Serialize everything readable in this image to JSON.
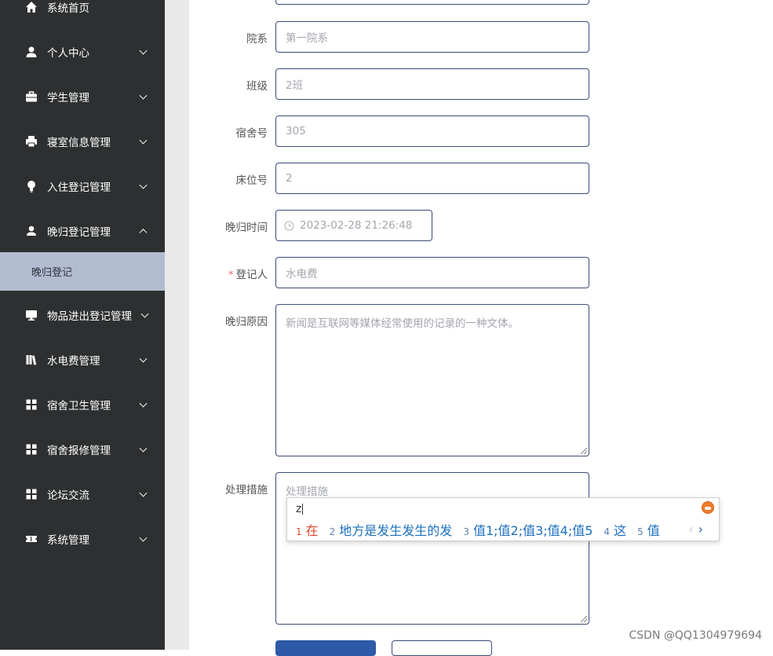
{
  "sidebar": {
    "items": [
      {
        "label": "系统首页",
        "icon": "home-icon"
      },
      {
        "label": "个人中心",
        "icon": "person-icon"
      },
      {
        "label": "学生管理",
        "icon": "briefcase-icon"
      },
      {
        "label": "寝室信息管理",
        "icon": "printer-icon"
      },
      {
        "label": "入住登记管理",
        "icon": "lightbulb-icon"
      },
      {
        "label": "晚归登记管理",
        "icon": "user-icon"
      },
      {
        "label": "物品进出登记管理",
        "icon": "monitor-icon"
      },
      {
        "label": "水电费管理",
        "icon": "book-icon"
      },
      {
        "label": "宿舍卫生管理",
        "icon": "grid-icon"
      },
      {
        "label": "宿舍报修管理",
        "icon": "grid-icon"
      },
      {
        "label": "论坛交流",
        "icon": "grid-icon"
      },
      {
        "label": "系统管理",
        "icon": "ticket-icon"
      }
    ],
    "sub_item": "晚归登记"
  },
  "form": {
    "department": {
      "label": "院系",
      "value": "第一院系"
    },
    "class": {
      "label": "班级",
      "value": "2班"
    },
    "dorm_no": {
      "label": "宿舍号",
      "value": "305"
    },
    "bed_no": {
      "label": "床位号",
      "value": "2"
    },
    "late_time": {
      "label": "晚归时间",
      "value": "2023-02-28 21:26:48"
    },
    "registrar": {
      "label": "登记人",
      "value": "水电费",
      "required_mark": "*"
    },
    "reason": {
      "label": "晚归原因",
      "value": "新闻是互联网等媒体经常使用的记录的一种文体。"
    },
    "measures": {
      "label": "处理措施",
      "placeholder": "处理措施"
    }
  },
  "ime": {
    "composition": "z",
    "candidates": [
      {
        "num": "1",
        "text": "在"
      },
      {
        "num": "2",
        "text": "地方是发生发生的发"
      },
      {
        "num": "3",
        "text": "值1;值2;值3;值4;值5"
      },
      {
        "num": "4",
        "text": "这"
      },
      {
        "num": "5",
        "text": "值"
      }
    ],
    "prev": "‹",
    "next": "›"
  },
  "watermark": "CSDN @QQ1304979694",
  "colors": {
    "sidebar_bg": "#2d2f30",
    "sub_item_bg": "#b2bcd0",
    "input_border": "#3c4c7a",
    "primary_button": "#2d5aa8"
  }
}
